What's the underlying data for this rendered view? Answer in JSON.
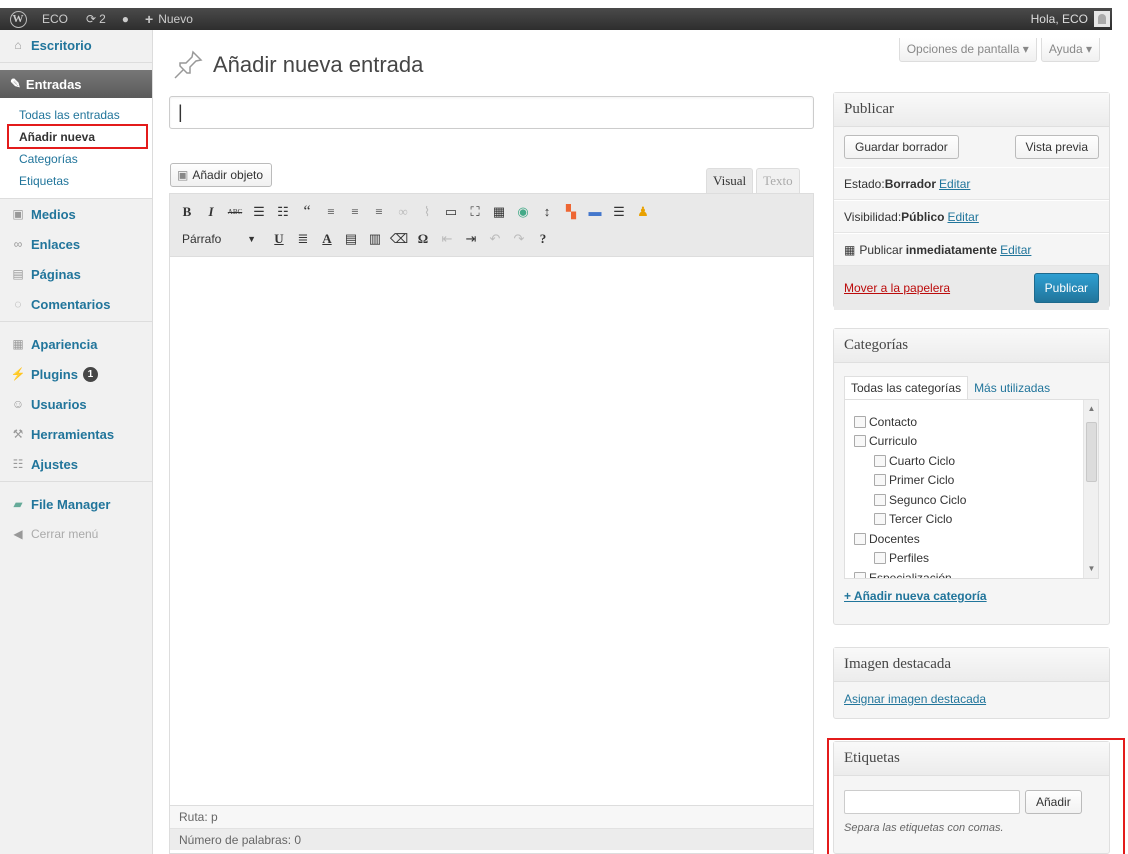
{
  "adminbar": {
    "wp_logo": "W",
    "site": "ECO",
    "updates_count": "2",
    "new_label": "Nuevo",
    "greeting": "Hola, ECO"
  },
  "sidebar": {
    "escritorio": "Escritorio",
    "entradas": "Entradas",
    "sub": {
      "todas": "Todas las entradas",
      "anadir": "Añadir nueva",
      "categorias": "Categorías",
      "etiquetas": "Etiquetas"
    },
    "medios": "Medios",
    "enlaces": "Enlaces",
    "paginas": "Páginas",
    "comentarios": "Comentarios",
    "apariencia": "Apariencia",
    "plugins": "Plugins",
    "plugins_badge": "1",
    "usuarios": "Usuarios",
    "herramientas": "Herramientas",
    "ajustes": "Ajustes",
    "file_manager": "File Manager",
    "cerrar": "Cerrar menú"
  },
  "header": {
    "screen_options": "Opciones de pantalla ▾",
    "help": "Ayuda ▾",
    "title": "Añadir nueva entrada"
  },
  "editor": {
    "add_media": "Añadir objeto",
    "tab_visual": "Visual",
    "tab_text": "Texto",
    "format": "Párrafo",
    "path": "Ruta: p",
    "word_count": "Número de palabras: 0"
  },
  "publish": {
    "title": "Publicar",
    "save_draft": "Guardar borrador",
    "preview": "Vista previa",
    "status_label": "Estado: ",
    "status_value": "Borrador",
    "visibility_label": "Visibilidad: ",
    "visibility_value": "Público",
    "schedule_label": "Publicar ",
    "schedule_value": "inmediatamente",
    "edit": "Editar",
    "trash": "Mover a la papelera",
    "publish": "Publicar"
  },
  "categories": {
    "title": "Categorías",
    "tab_all": "Todas las categorías",
    "tab_popular": "Más utilizadas",
    "items": [
      "Contacto",
      "Curriculo",
      "Cuarto Ciclo",
      "Primer Ciclo",
      "Segunco Ciclo",
      "Tercer Ciclo",
      "Docentes",
      "Perfiles",
      "Especialización"
    ],
    "add_new": "+ Añadir nueva categoría"
  },
  "featured": {
    "title": "Imagen destacada",
    "set": "Asignar imagen destacada"
  },
  "tags": {
    "title": "Etiquetas",
    "add": "Añadir",
    "hint": "Separa las etiquetas con comas."
  },
  "colors": {
    "highlight": "#e31b1b",
    "link": "#21759b",
    "primary": "#21759b"
  }
}
